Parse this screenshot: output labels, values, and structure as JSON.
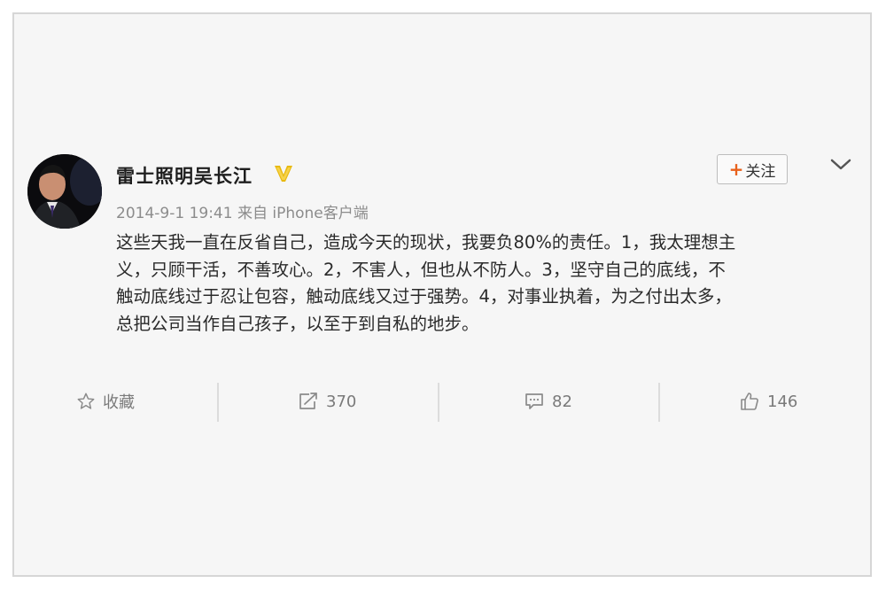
{
  "post": {
    "author_name": "雷士照明吴长江",
    "meta": "2014-9-1 19:41 来自 iPhone客户端",
    "follow_label": "关注",
    "content_lines": [
      "这些天我一直在反省自己，造成今天的现状，我要负80%的责任。1，我太理想主",
      "义，只顾干活，不善攻心。2，不害人，但也从不防人。3，坚守自己的底线，不",
      "触动底线过于忍让包容，触动底线又过于强势。4，对事业执着，为之付出太多，",
      "总把公司当作自己孩子，以至于到自私的地步。"
    ]
  },
  "actions": {
    "favorite_label": "收藏",
    "repost_count": "370",
    "comment_count": "82",
    "like_count": "146"
  },
  "icons": {
    "verified": "verified-v-icon",
    "favorite": "star-icon",
    "repost": "share-arrow-icon",
    "comment": "comment-bubble-icon",
    "like": "thumbs-up-icon",
    "menu": "chevron-down-icon"
  },
  "colors": {
    "follow_plus": "#e8611c",
    "verified_badge": "#e8b90e",
    "meta_text": "#8c8c8c"
  }
}
